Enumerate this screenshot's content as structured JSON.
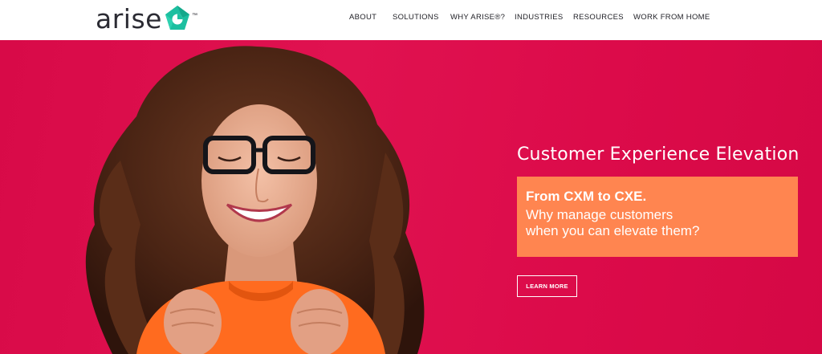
{
  "brand": {
    "name": "arise",
    "trademark": "™",
    "icon": "pentagon-swirl-logo-icon",
    "accent_color": "#1dbfa0"
  },
  "nav": {
    "items": [
      {
        "label": "ABOUT"
      },
      {
        "label": "SOLUTIONS"
      },
      {
        "label": "WHY ARISE®?"
      },
      {
        "label": "INDUSTRIES"
      },
      {
        "label": "RESOURCES"
      },
      {
        "label": "WORK FROM HOME"
      }
    ]
  },
  "hero": {
    "background_color": "#dc0b4a",
    "image_subject": "smiling woman with glasses",
    "headline": "Customer Experience Elevation",
    "box": {
      "strong": "From CXM to CXE.",
      "line1": "Why manage customers",
      "line2": "when you can elevate them?",
      "color": "#ff8550"
    },
    "cta_label": "LEARN MORE"
  }
}
